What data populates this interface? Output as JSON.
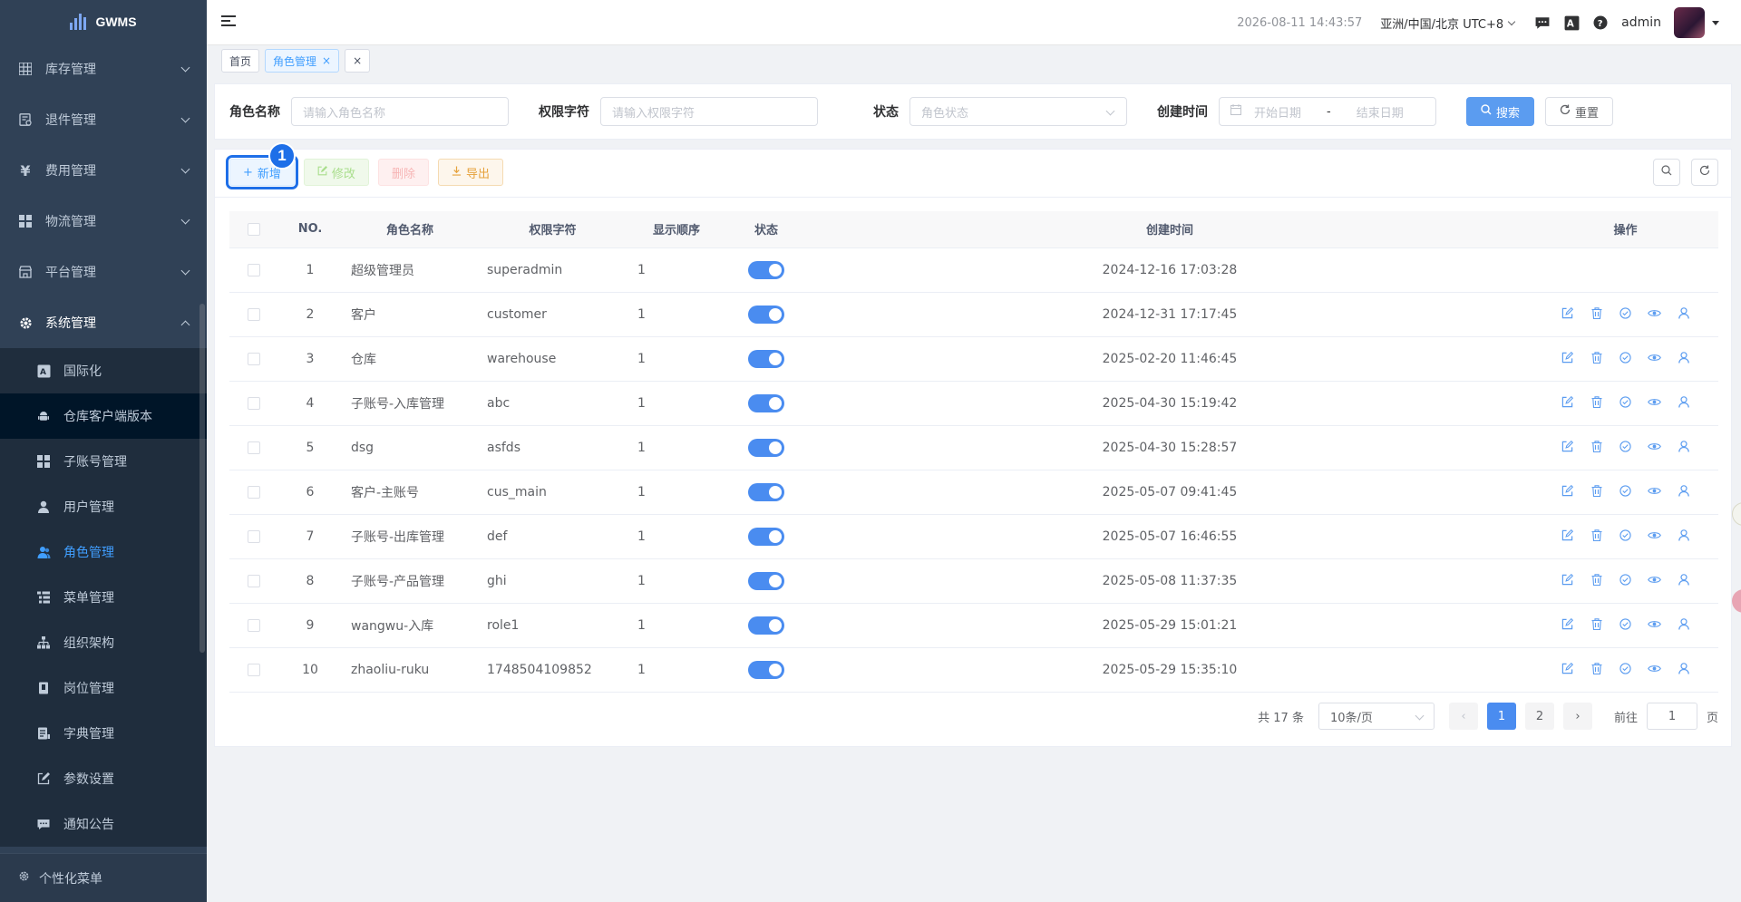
{
  "app": {
    "name": "GWMS"
  },
  "sidebar": {
    "groups": [
      {
        "label": "库存管理",
        "icon": "grid-icon"
      },
      {
        "label": "退件管理",
        "icon": "return-doc-icon"
      },
      {
        "label": "费用管理",
        "icon": "yen-icon"
      },
      {
        "label": "物流管理",
        "icon": "apps-icon"
      },
      {
        "label": "平台管理",
        "icon": "shop-icon"
      },
      {
        "label": "系统管理",
        "icon": "gear-icon"
      }
    ],
    "sub_items": [
      {
        "label": "国际化",
        "icon": "translate-icon"
      },
      {
        "label": "仓库客户端版本",
        "icon": "android-icon"
      },
      {
        "label": "子账号管理",
        "icon": "apps-icon"
      },
      {
        "label": "用户管理",
        "icon": "user-icon"
      },
      {
        "label": "角色管理",
        "icon": "users-icon"
      },
      {
        "label": "菜单管理",
        "icon": "tree-table-icon"
      },
      {
        "label": "组织架构",
        "icon": "org-icon"
      },
      {
        "label": "岗位管理",
        "icon": "post-icon"
      },
      {
        "label": "字典管理",
        "icon": "dict-icon"
      },
      {
        "label": "参数设置",
        "icon": "edit-icon"
      },
      {
        "label": "通知公告",
        "icon": "message-icon"
      }
    ],
    "footer": "个性化菜单"
  },
  "topbar": {
    "datetime": "2026-08-11 14:43:57",
    "timezone": "亚洲/中国/北京 UTC+8",
    "user": "admin"
  },
  "tags": {
    "home": "首页",
    "current": "角色管理"
  },
  "search": {
    "role_name_label": "角色名称",
    "role_name_placeholder": "请输入角色名称",
    "perm_label": "权限字符",
    "perm_placeholder": "请输入权限字符",
    "status_label": "状态",
    "status_placeholder": "角色状态",
    "created_label": "创建时间",
    "start_placeholder": "开始日期",
    "range_sep": "-",
    "end_placeholder": "结束日期",
    "search_btn": "搜索",
    "reset_btn": "重置"
  },
  "toolbar": {
    "add": "新增",
    "edit": "修改",
    "delete": "删除",
    "export": "导出",
    "badge": "1"
  },
  "table": {
    "headers": [
      "NO.",
      "角色名称",
      "权限字符",
      "显示顺序",
      "状态",
      "创建时间",
      "操作"
    ],
    "rows": [
      {
        "no": "1",
        "name": "超级管理员",
        "key": "superadmin",
        "sort": "1",
        "time": "2024-12-16 17:03:28",
        "ops": false
      },
      {
        "no": "2",
        "name": "客户",
        "key": "customer",
        "sort": "1",
        "time": "2024-12-31 17:17:45",
        "ops": true
      },
      {
        "no": "3",
        "name": "仓库",
        "key": "warehouse",
        "sort": "1",
        "time": "2025-02-20 11:46:45",
        "ops": true
      },
      {
        "no": "4",
        "name": "子账号-入库管理",
        "key": "abc",
        "sort": "1",
        "time": "2025-04-30 15:19:42",
        "ops": true
      },
      {
        "no": "5",
        "name": "dsg",
        "key": "asfds",
        "sort": "1",
        "time": "2025-04-30 15:28:57",
        "ops": true
      },
      {
        "no": "6",
        "name": "客户-主账号",
        "key": "cus_main",
        "sort": "1",
        "time": "2025-05-07 09:41:45",
        "ops": true
      },
      {
        "no": "7",
        "name": "子账号-出库管理",
        "key": "def",
        "sort": "1",
        "time": "2025-05-07 16:46:55",
        "ops": true
      },
      {
        "no": "8",
        "name": "子账号-产品管理",
        "key": "ghi",
        "sort": "1",
        "time": "2025-05-08 11:37:35",
        "ops": true
      },
      {
        "no": "9",
        "name": "wangwu-入库",
        "key": "role1",
        "sort": "1",
        "time": "2025-05-29 15:01:21",
        "ops": true
      },
      {
        "no": "10",
        "name": "zhaoliu-ruku",
        "key": "1748504109852",
        "sort": "1",
        "time": "2025-05-29 15:35:10",
        "ops": true
      }
    ]
  },
  "pagination": {
    "total": "共 17 条",
    "page_size": "10条/页",
    "pages": [
      "1",
      "2"
    ],
    "goto": "前往",
    "goto_value": "1",
    "page_unit": "页"
  },
  "colors": {
    "primary": "#409eff",
    "sidebar_bg": "#304156",
    "switch_on": "#4a8cf0"
  }
}
